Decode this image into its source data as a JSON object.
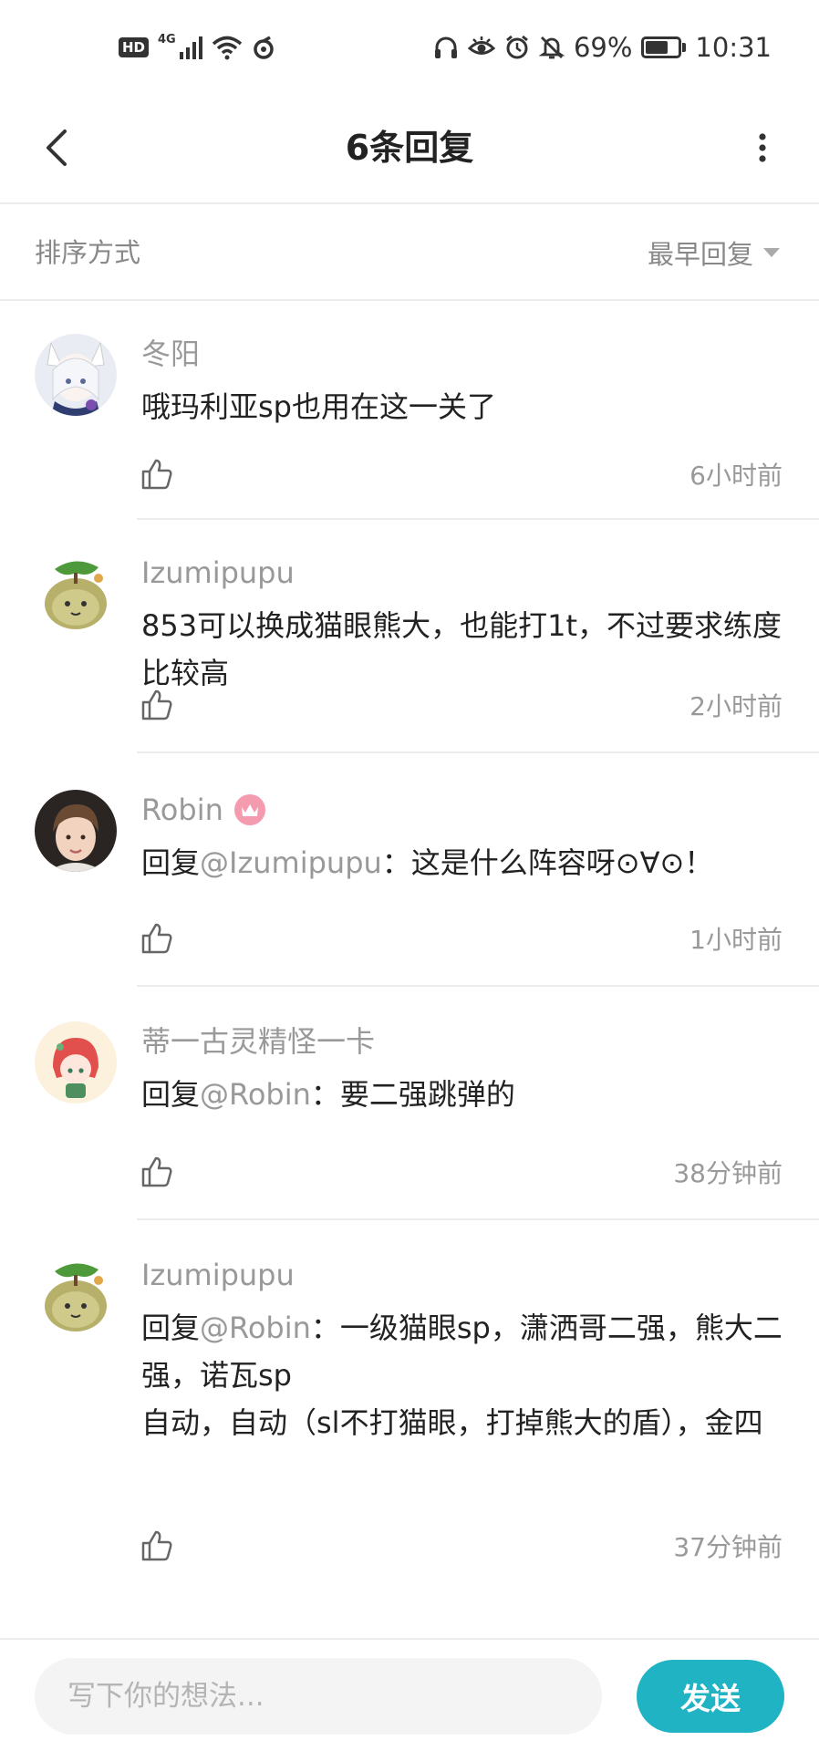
{
  "status_bar": {
    "hd": "HD",
    "network": "4G",
    "battery_percent": "69%",
    "battery_level": 0.69,
    "time": "10:31",
    "icons": [
      "hd-icon",
      "signal-icon",
      "wifi-icon",
      "sync-icon",
      "headphones-icon",
      "eye-icon",
      "alarm-icon",
      "bell-off-icon",
      "battery-icon"
    ]
  },
  "header": {
    "title": "6条回复",
    "back_icon": "chevron-left-icon",
    "more_icon": "more-vertical-icon"
  },
  "sort": {
    "label": "排序方式",
    "value": "最早回复",
    "icon": "caret-down-icon"
  },
  "replies": [
    {
      "username": "冬阳",
      "avatar": "fox-girl-avatar",
      "content": "哦玛利亚sp也用在这一关了",
      "mention": "",
      "time": "6小时前",
      "badge": false
    },
    {
      "username": "Izumipupu",
      "avatar": "green-creature-avatar",
      "content": "853可以换成猫眼熊大，也能打1t，不过要求练度比较高",
      "mention": "",
      "time": "2小时前",
      "badge": false
    },
    {
      "username": "Robin",
      "avatar": "person-avatar",
      "reply_prefix": "回复",
      "mention": "@Izumipupu",
      "content": "：这是什么阵容呀⊙∀⊙！",
      "time": "1小时前",
      "badge": true,
      "badge_icon": "crown-icon"
    },
    {
      "username": "蒂一古灵精怪一卡",
      "avatar": "red-hair-girl-avatar",
      "reply_prefix": "回复",
      "mention": "@Robin",
      "content": "：要二强跳弹的",
      "time": "38分钟前",
      "badge": false
    },
    {
      "username": "Izumipupu",
      "avatar": "green-creature-avatar",
      "reply_prefix": "回复",
      "mention": "@Robin",
      "content": "：一级猫眼sp，潇洒哥二强，熊大二强，诺瓦sp\n自动，自动（sl不打猫眼，打掉熊大的盾），金四",
      "time": "37分钟前",
      "badge": false
    }
  ],
  "input": {
    "placeholder": "写下你的想法..."
  },
  "send_label": "发送",
  "colors": {
    "accent": "#1fb3c4",
    "secondary_text": "#999999",
    "primary_text": "#222222",
    "divider": "#ececec"
  }
}
